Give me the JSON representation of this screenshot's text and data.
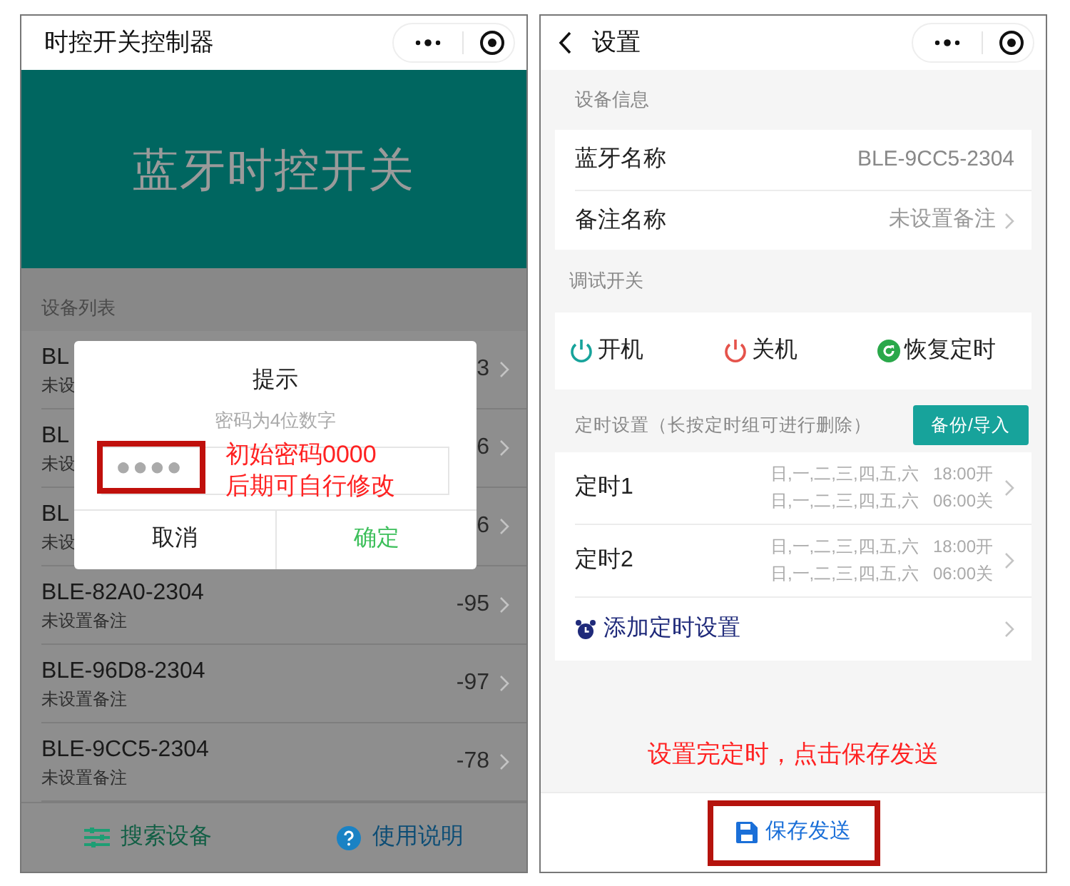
{
  "left_screen": {
    "nav": {
      "title": "时控开关控制器"
    },
    "banner": {
      "title": "蓝牙时控开关"
    },
    "section_label": "设备列表",
    "devices": [
      {
        "name": "BL",
        "note": "未设",
        "rssi": "3"
      },
      {
        "name": "BL",
        "note": "未设",
        "rssi": "6"
      },
      {
        "name": "BL",
        "note": "未设",
        "rssi": "6"
      },
      {
        "name": "BLE-82A0-2304",
        "note": "未设置备注",
        "rssi": "-95"
      },
      {
        "name": "BLE-96D8-2304",
        "note": "未设置备注",
        "rssi": "-97"
      },
      {
        "name": "BLE-9CC5-2304",
        "note": "未设置备注",
        "rssi": "-78"
      }
    ],
    "dialog": {
      "title": "提示",
      "message": "密码为4位数字",
      "value": "●●●●",
      "cancel": "取消",
      "confirm": "确定"
    },
    "annotation": [
      "初始密码0000",
      "后期可自行修改"
    ],
    "bottom_bar": [
      {
        "kind": "search",
        "label": "搜索设备"
      },
      {
        "kind": "help",
        "label": "使用说明"
      }
    ]
  },
  "right_screen": {
    "nav": {
      "title": "设置"
    },
    "info_header": "设备信息",
    "info_rows": [
      {
        "label": "蓝牙名称",
        "value": "BLE-9CC5-2304",
        "chevron": false
      },
      {
        "label": "备注名称",
        "value": "未设置备注",
        "chevron": true
      }
    ],
    "debug_header": "调试开关",
    "actions": [
      {
        "kind": "on",
        "label": "开机"
      },
      {
        "kind": "off",
        "label": "关机"
      },
      {
        "kind": "restore",
        "label": "恢复定时"
      }
    ],
    "timer_header": "定时设置（长按定时组可进行删除）",
    "backup_button": "备份/导入",
    "timers": [
      {
        "name": "定时1",
        "lines": [
          {
            "days": "日,一,二,三,四,五,六",
            "time": "18:00开"
          },
          {
            "days": "日,一,二,三,四,五,六",
            "time": "06:00关"
          }
        ]
      },
      {
        "name": "定时2",
        "lines": [
          {
            "days": "日,一,二,三,四,五,六",
            "time": "18:00开"
          },
          {
            "days": "日,一,二,三,四,五,六",
            "time": "06:00关"
          }
        ]
      }
    ],
    "add_timer": "添加定时设置",
    "annotation": "设置完定时，点击保存发送",
    "save_button": "保存发送"
  }
}
